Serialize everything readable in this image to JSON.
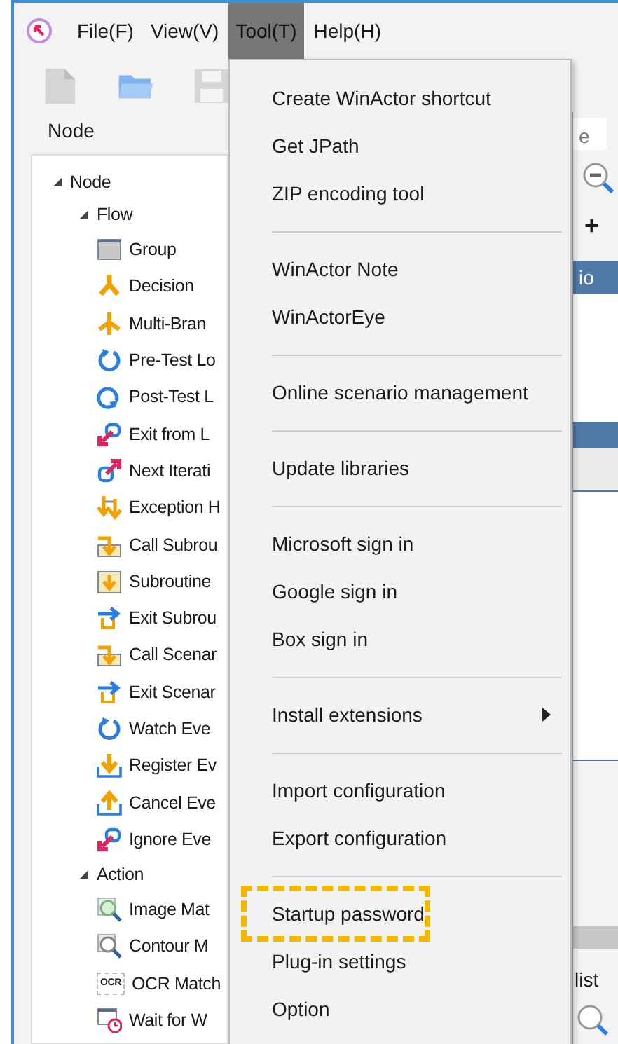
{
  "menubar": [
    {
      "label": "File(F)",
      "selected": false
    },
    {
      "label": "View(V)",
      "selected": false
    },
    {
      "label": "Tool(T)",
      "selected": true
    },
    {
      "label": "Help(H)",
      "selected": false
    }
  ],
  "panel": {
    "title": "Node"
  },
  "tree": [
    {
      "label": "Node",
      "expanded": true,
      "children": [
        {
          "label": "Flow",
          "expanded": true,
          "children": [
            {
              "label": "Group",
              "kind": "group"
            },
            {
              "label": "Decision",
              "kind": "branch"
            },
            {
              "label": "Multi-Bran",
              "kind": "multi"
            },
            {
              "label": "Pre-Test Lo",
              "kind": "loop"
            },
            {
              "label": "Post-Test L",
              "kind": "loop-post"
            },
            {
              "label": "Exit from L",
              "kind": "exit-loop"
            },
            {
              "label": "Next Iterati",
              "kind": "next"
            },
            {
              "label": "Exception H",
              "kind": "exception"
            },
            {
              "label": "Call Subrou",
              "kind": "call"
            },
            {
              "label": "Subroutine",
              "kind": "subroutine"
            },
            {
              "label": "Exit Subrou",
              "kind": "exit"
            },
            {
              "label": "Call Scenar",
              "kind": "call"
            },
            {
              "label": "Exit Scenar",
              "kind": "exit"
            },
            {
              "label": "Watch Eve",
              "kind": "loop"
            },
            {
              "label": "Register Ev",
              "kind": "register"
            },
            {
              "label": "Cancel Eve",
              "kind": "cancel"
            },
            {
              "label": "Ignore Eve",
              "kind": "exit-loop"
            }
          ]
        },
        {
          "label": "Action",
          "expanded": true,
          "children": [
            {
              "label": "Image Mat",
              "kind": "image-match"
            },
            {
              "label": "Contour M",
              "kind": "contour"
            },
            {
              "label": "OCR Match",
              "kind": "ocr",
              "badge": "OCR"
            },
            {
              "label": "Wait for W",
              "kind": "wait"
            }
          ]
        }
      ]
    }
  ],
  "right_strip": [
    {
      "kind": "tab",
      "label": "e"
    },
    {
      "kind": "zoom-out"
    },
    {
      "kind": "plus",
      "label": "+"
    },
    {
      "kind": "selected-row",
      "label": "io"
    },
    {
      "kind": "blank"
    },
    {
      "kind": "header"
    },
    {
      "kind": "band"
    },
    {
      "kind": "list-area"
    },
    {
      "kind": "scrollbar"
    },
    {
      "kind": "text",
      "label": "list"
    },
    {
      "kind": "search"
    }
  ],
  "menu": [
    {
      "kind": "item",
      "label": "Create WinActor shortcut"
    },
    {
      "kind": "item",
      "label": "Get JPath"
    },
    {
      "kind": "item",
      "label": "ZIP encoding tool"
    },
    {
      "kind": "separator"
    },
    {
      "kind": "item",
      "label": "WinActor Note"
    },
    {
      "kind": "item",
      "label": "WinActorEye"
    },
    {
      "kind": "separator"
    },
    {
      "kind": "item",
      "label": "Online scenario management"
    },
    {
      "kind": "separator"
    },
    {
      "kind": "item",
      "label": "Update libraries"
    },
    {
      "kind": "separator"
    },
    {
      "kind": "item",
      "label": "Microsoft sign in"
    },
    {
      "kind": "item",
      "label": "Google sign in"
    },
    {
      "kind": "item",
      "label": "Box sign in"
    },
    {
      "kind": "separator"
    },
    {
      "kind": "item",
      "label": "Install extensions",
      "submenu": true
    },
    {
      "kind": "separator"
    },
    {
      "kind": "item",
      "label": "Import configuration"
    },
    {
      "kind": "item",
      "label": "Export configuration"
    },
    {
      "kind": "separator"
    },
    {
      "kind": "item",
      "label": "Startup password",
      "highlighted": true
    },
    {
      "kind": "item",
      "label": "Plug-in settings"
    },
    {
      "kind": "item",
      "label": "Option"
    }
  ]
}
